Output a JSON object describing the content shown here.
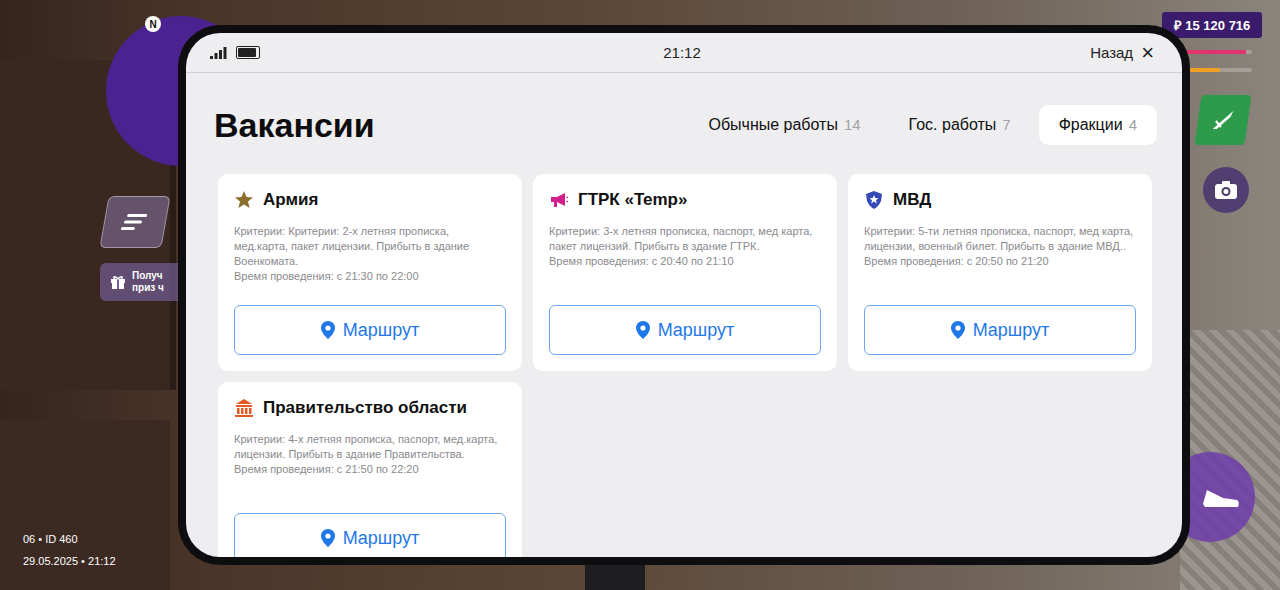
{
  "hud": {
    "compass": "N",
    "money": "₽ 15 120 716",
    "stat_bars": [
      {
        "level": 0.92,
        "color": "#e2336f"
      },
      {
        "level": 0.6,
        "color": "#f0a024"
      }
    ],
    "gift_button": [
      "Получ",
      "приз ч"
    ],
    "player_line": "06 • ID 460",
    "datetime": "29.05.2025 • 21:12"
  },
  "status_bar": {
    "signal": {
      "level": 1
    },
    "battery": {
      "level": 0.9
    },
    "time": "21:12",
    "back": "Назад",
    "close": "×"
  },
  "page": {
    "title": "Вакансии"
  },
  "tabs": [
    {
      "label": "Обычные работы",
      "count": "14",
      "selected": false
    },
    {
      "label": "Гос. работы",
      "count": "7",
      "selected": false
    },
    {
      "label": "Фракции",
      "count": "4",
      "selected": true
    }
  ],
  "cards": [
    {
      "kind": "army",
      "title": "Армия",
      "criteria": "Критерии: Критерии: 2-х летняя прописка, мед.карта, пакет лицензии. Прибыть в здание Военкомата.",
      "time": "Время проведения: с 21:30 по 22:00",
      "button": "Маршрут"
    },
    {
      "kind": "tv",
      "title": "ГТРК «Temp»",
      "criteria": "Критерии: 3-х летняя прописка, паспорт, мед карта, пакет лицензий. Прибыть в здание ГТРК.",
      "time": "Время проведения: с 20:40 по 21:10",
      "button": "Маршрут"
    },
    {
      "kind": "police",
      "title": "МВД",
      "criteria": "Критерии:  5-ти летняя прописка, паспорт, мед карта, лицензии, военный билет. Прибыть в здание МВД..",
      "time": "Время проведения: с 20:50 по 21:20",
      "button": "Маршрут"
    },
    {
      "kind": "government",
      "title": "Правительство области",
      "criteria": "Критерии: 4-х летняя прописка, паспорт, мед.карта, лицензии. Прибыть в здание Правительства.",
      "time": "Время проведения: с 21:50 по 22:20",
      "button": "Маршрут"
    }
  ]
}
